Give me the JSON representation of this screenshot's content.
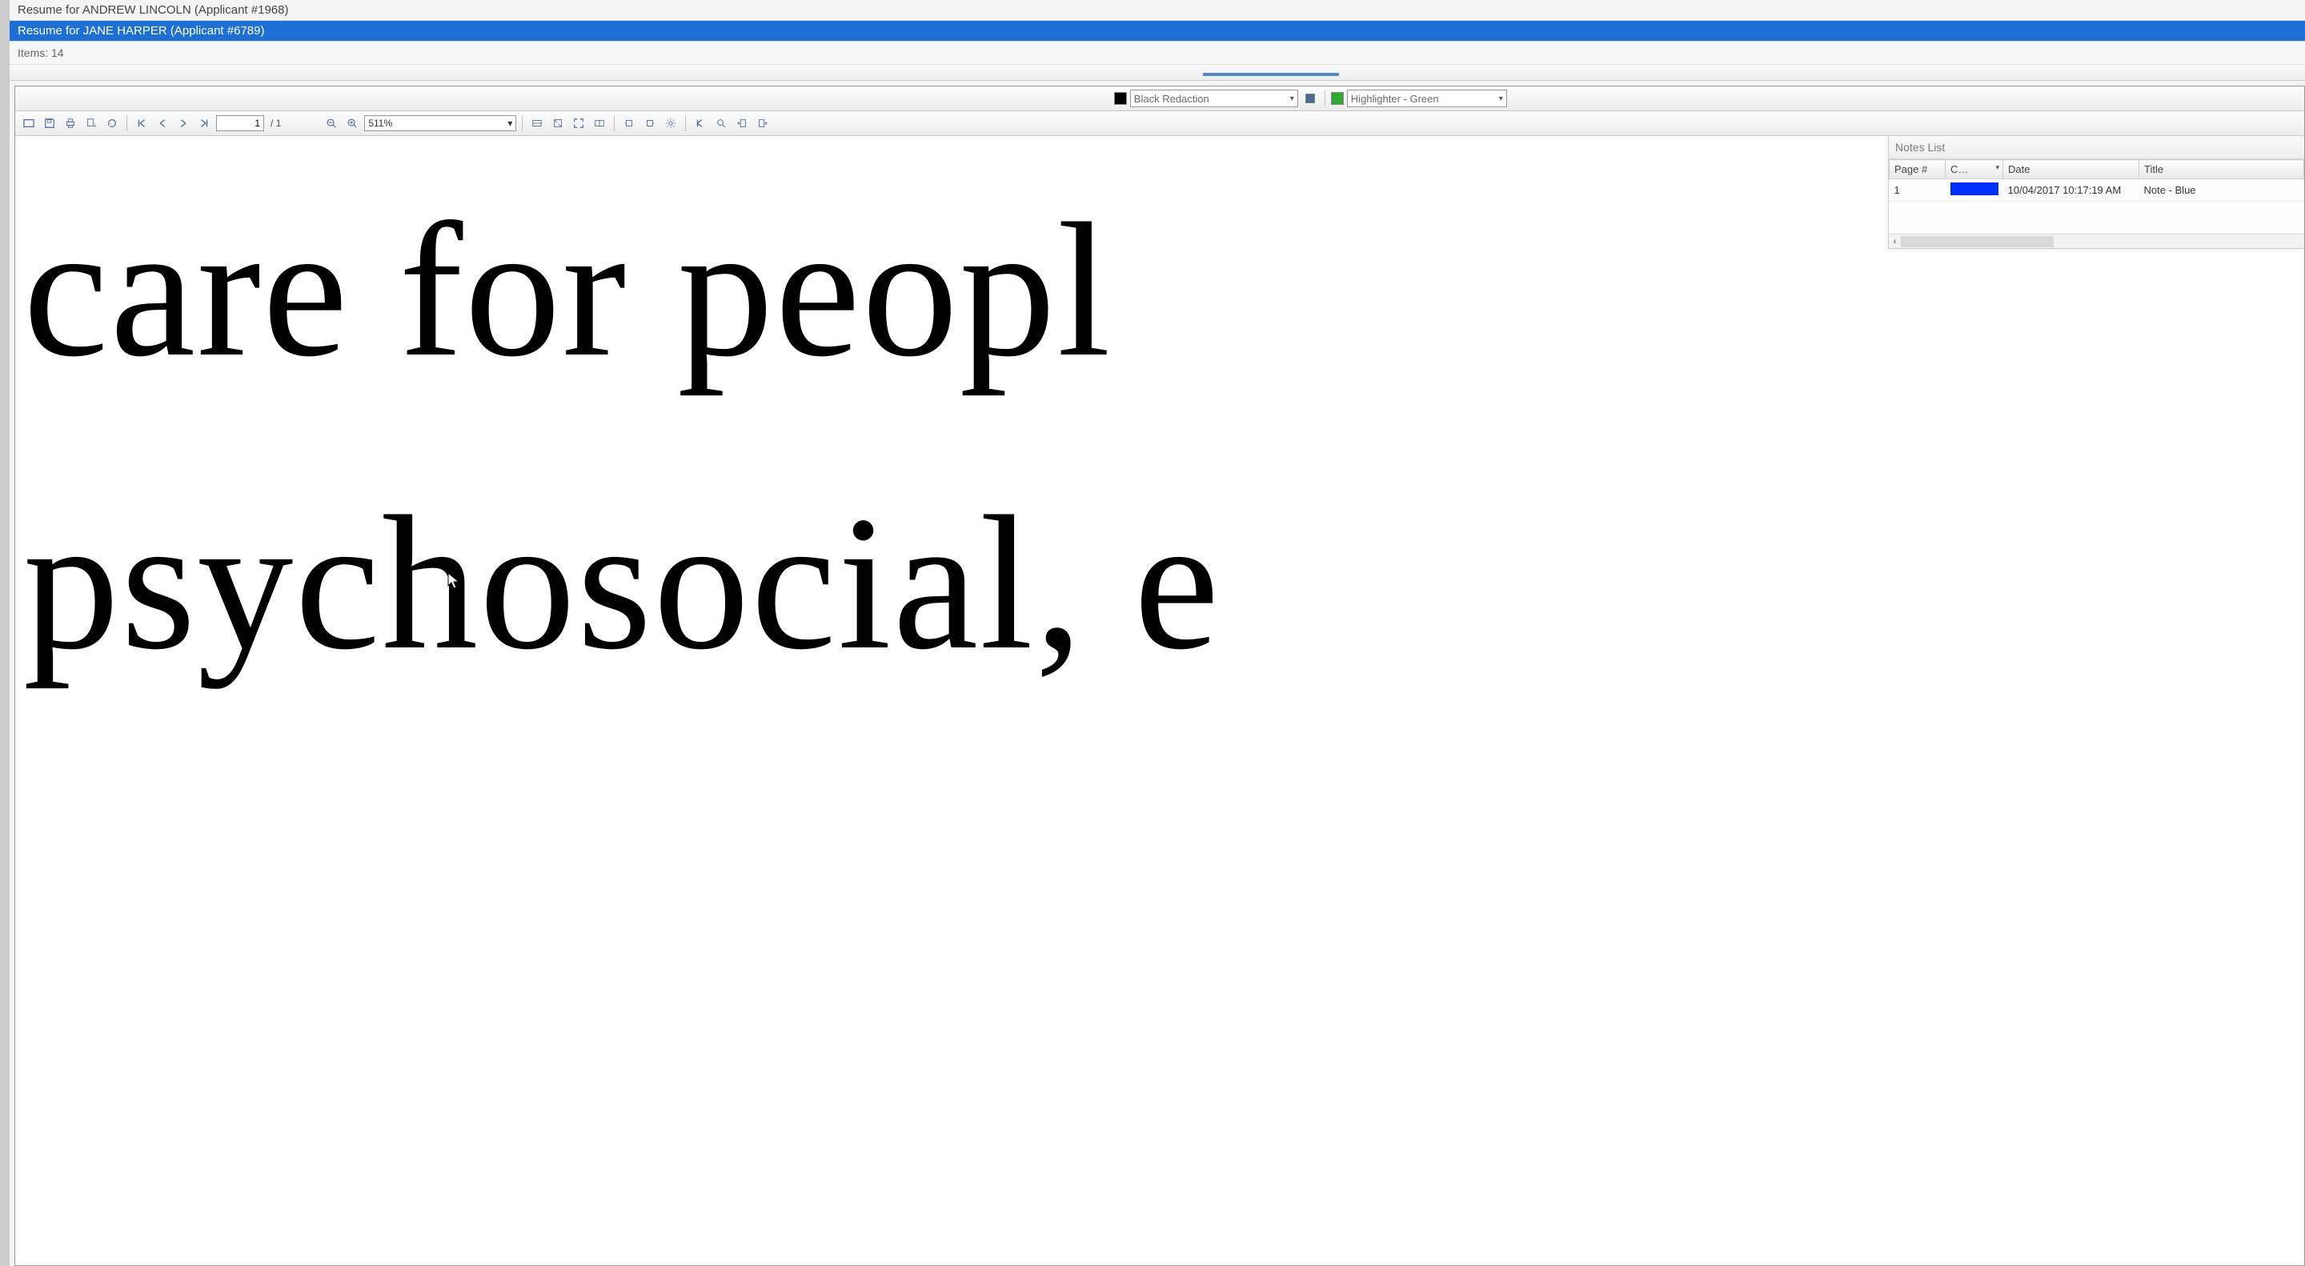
{
  "tabs": [
    {
      "label": "Resume for ANDREW LINCOLN (Applicant #1968)",
      "active": false
    },
    {
      "label": "Resume for JANE HARPER (Applicant #6789)",
      "active": true
    }
  ],
  "items_label": "Items: 14",
  "redaction": {
    "label": "Black Redaction"
  },
  "highlighter": {
    "label": "Highlighter - Green"
  },
  "page": {
    "current": "1",
    "total": "/ 1"
  },
  "zoom": {
    "value": "511%"
  },
  "document": {
    "line1": "care for peopl",
    "line2": "psychosocial, e"
  },
  "notes_panel": {
    "title": "Notes List",
    "columns": {
      "page": "Page #",
      "color": "C…",
      "date": "Date",
      "title": "Title"
    },
    "rows": [
      {
        "page": "1",
        "color": "#0030ff",
        "date": "10/04/2017 10:17:19 AM",
        "title": "Note - Blue"
      }
    ]
  },
  "icons": {
    "first": "first-page",
    "prev": "prev-page",
    "next": "next-page",
    "last": "last-page"
  }
}
